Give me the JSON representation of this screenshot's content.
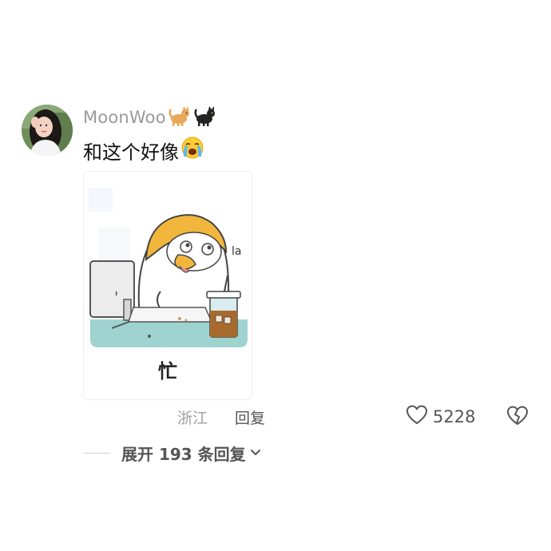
{
  "comment": {
    "username": "MoonWoo",
    "name_emojis": [
      "cat-icon",
      "black-cat-icon"
    ],
    "text": "和这个好像",
    "text_emoji": "crying-face-icon",
    "sticker": {
      "caption": "忙",
      "side_text": "la"
    },
    "location": "浙江",
    "reply_label": "回复",
    "like_count": "5228",
    "expand_replies_label": "展开 193 条回复"
  },
  "colors": {
    "username": "#9a9a9a",
    "text": "#111111",
    "meta": "#a0a0a0",
    "action": "#555555",
    "sticker_teal": "#9fd3cf",
    "duck_yellow": "#f2b63c"
  }
}
